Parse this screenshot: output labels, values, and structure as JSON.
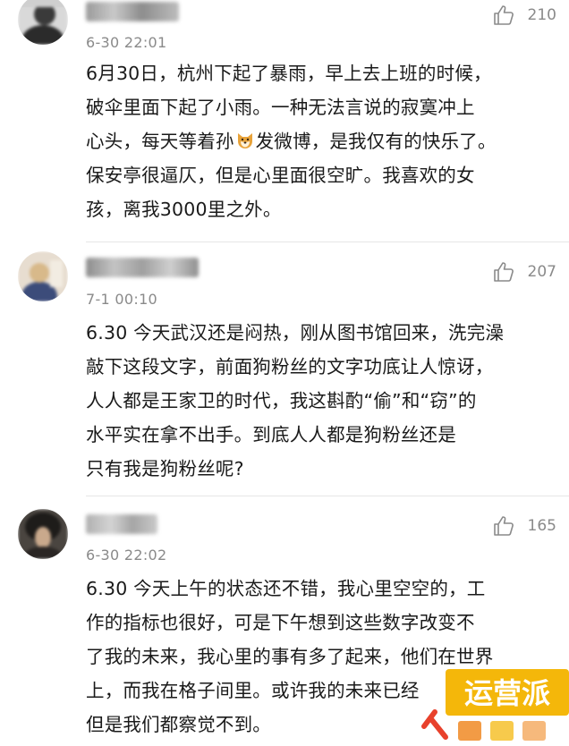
{
  "comments": [
    {
      "time": "6-30 22:01",
      "likes": "210",
      "line1": "6月30日，杭州下起了暴雨，早上去上班的时候，",
      "line2": "破伞里面下起了小雨。一种无法言说的寂寞冲上",
      "line3a": "心头，每天等着孙",
      "line3b": "发微博，是我仅有的快乐了。",
      "line4": "保安亭很逼仄，但是心里面很空旷。我喜欢的女",
      "line5": "孩，离我3000里之外。"
    },
    {
      "time": "7-1 00:10",
      "likes": "207",
      "line1": "6.30 今天武汉还是闷热，刚从图书馆回来，洗完澡",
      "line2": "敲下这段文字，前面狗粉丝的文字功底让人惊讶，",
      "line3": "人人都是王家卫的时代，我这斟酌“偷”和“窃”的",
      "line4": "水平实在拿不出手。到底人人都是狗粉丝还是",
      "line5": "只有我是狗粉丝呢?"
    },
    {
      "time": "6-30 22:02",
      "likes": "165",
      "line1": "6.30 今天上午的状态还不错，我心里空空的，工",
      "line2": "作的指标也很好，可是下午想到这些数字改变不",
      "line3": "了我的未来，我心里的事有多了起来，他们在世界",
      "line4": "上，而我在格子间里。或许我的未来已经",
      "line5": "但是我们都察觉不到。"
    }
  ],
  "watermark": {
    "text": "运营派"
  }
}
